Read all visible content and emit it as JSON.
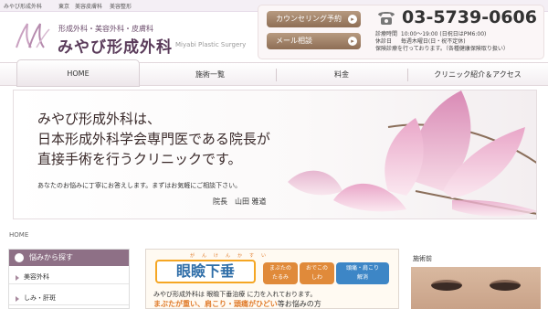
{
  "topbar": {
    "items": [
      "みやび形成外科",
      "東京",
      "美容皮膚科",
      "美容整形"
    ]
  },
  "logo": {
    "subtitle": "形成外科・美容外科・皮膚科",
    "title": "みやび形成外科",
    "english": "Miyabi Plastic Surgery"
  },
  "header": {
    "counsel_button": "カウンセリング予約",
    "mail_button": "メール相談",
    "phone": "03-5739-0606",
    "hours_label": "診療時間",
    "hours_value": "10:00〜19:00 (日祝日はPM6:00)",
    "closed_label": "休診日",
    "closed_value": "毎週木曜日(日・祝不定休)",
    "insurance_text": "保険診療を行っております。（各種健康保険取り扱い）"
  },
  "nav": {
    "items": [
      "HOME",
      "施術一覧",
      "料金",
      "クリニック紹介＆アクセス"
    ]
  },
  "hero": {
    "line1": "みやび形成外科は、",
    "line2": "日本形成外科学会専門医である院長が",
    "line3": "直接手術を行うクリニックです。",
    "message": "あなたのお悩みに丁寧にお答えします。まずはお気軽にご相談下さい。",
    "signature": "院長　山田 雅道"
  },
  "breadcrumb": "HOME",
  "sidebar": {
    "heading": "悩みから探す",
    "items": [
      "美容外科",
      "しみ・肝斑"
    ]
  },
  "feature": {
    "ruby": "がんけんかすい",
    "title": "眼瞼下垂",
    "tags": [
      "まぶたの\nたるみ",
      "おでこの\nしわ",
      "頭痛・肩こり\n解消"
    ],
    "line1": "みやび形成外科は 眼瞼下垂治療 に力を入れております。",
    "line2_highlight": "まぶたが重い、肩こり・頭痛がひどい",
    "line2_rest": "等お悩みの方"
  },
  "before": {
    "label": "施術前"
  },
  "colors": {
    "accent": "#8e7086",
    "button_brown": "#8e6e55",
    "feature_orange": "#f5a623",
    "feature_blue": "#2f6ea8"
  }
}
